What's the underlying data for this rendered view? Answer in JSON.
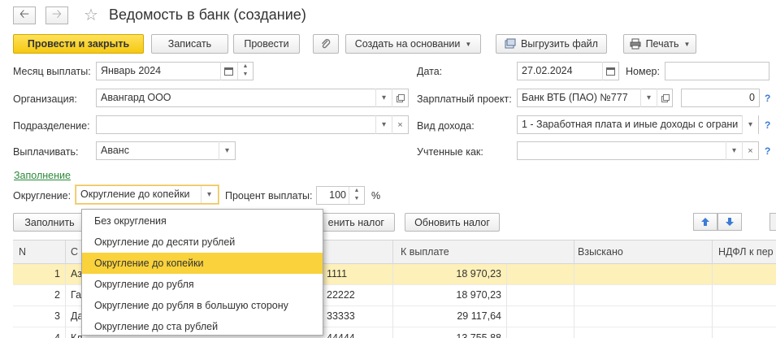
{
  "window": {
    "title": "Ведомость в банк (создание)"
  },
  "toolbar": {
    "post_close": "Провести и закрыть",
    "save": "Записать",
    "post": "Провести",
    "create_based": "Создать на основании",
    "export_file": "Выгрузить файл",
    "print": "Печать"
  },
  "form": {
    "month_label": "Месяц выплаты:",
    "month_value": "Январь 2024",
    "org_label": "Организация:",
    "org_value": "Авангард ООО",
    "dept_label": "Подразделение:",
    "dept_value": "",
    "pay_label": "Выплачивать:",
    "pay_value": "Аванс",
    "date_label": "Дата:",
    "date_value": "27.02.2024",
    "number_label": "Номер:",
    "number_value": "",
    "project_label": "Зарплатный проект:",
    "project_value": "Банк ВТБ (ПАО) №777",
    "project_num": "0",
    "income_label": "Вид дохода:",
    "income_value": "1 - Заработная плата и иные доходы с ограни",
    "accounted_label": "Учтенные как:",
    "accounted_value": "",
    "fill_link": "Заполнение",
    "rounding_label": "Округление:",
    "rounding_value": "Округление до копейки",
    "percent_label": "Процент выплаты:",
    "percent_value": "100",
    "percent_sign": "%"
  },
  "table_toolbar": {
    "fill": "Заполнить",
    "recalc_tax": "енить налог",
    "update_tax": "Обновить налог"
  },
  "table": {
    "columns": [
      "N",
      "С",
      "",
      "К выплате",
      "Взыскано",
      "НДФЛ к пер"
    ],
    "rows": [
      {
        "n": "1",
        "name": "Аз",
        "account": "1111",
        "amount": "18 970,23"
      },
      {
        "n": "2",
        "name": "Га",
        "account": "22222",
        "amount": "18 970,23"
      },
      {
        "n": "3",
        "name": "Да",
        "account": "33333",
        "amount": "29 117,64"
      },
      {
        "n": "4",
        "name": "Кл",
        "account": "44444",
        "amount": "13 755,88"
      }
    ]
  },
  "dropdown": {
    "options": [
      "Без округления",
      "Округление до десяти рублей",
      "Округление до копейки",
      "Округление до рубля",
      "Округление до рубля в большую сторону",
      "Округление до ста рублей"
    ],
    "selected_index": 2
  },
  "colors": {
    "primary_button": "#f5c912",
    "highlight": "#f9d23c",
    "selected_row": "#fdf0b8",
    "link": "#2a8a3a"
  }
}
